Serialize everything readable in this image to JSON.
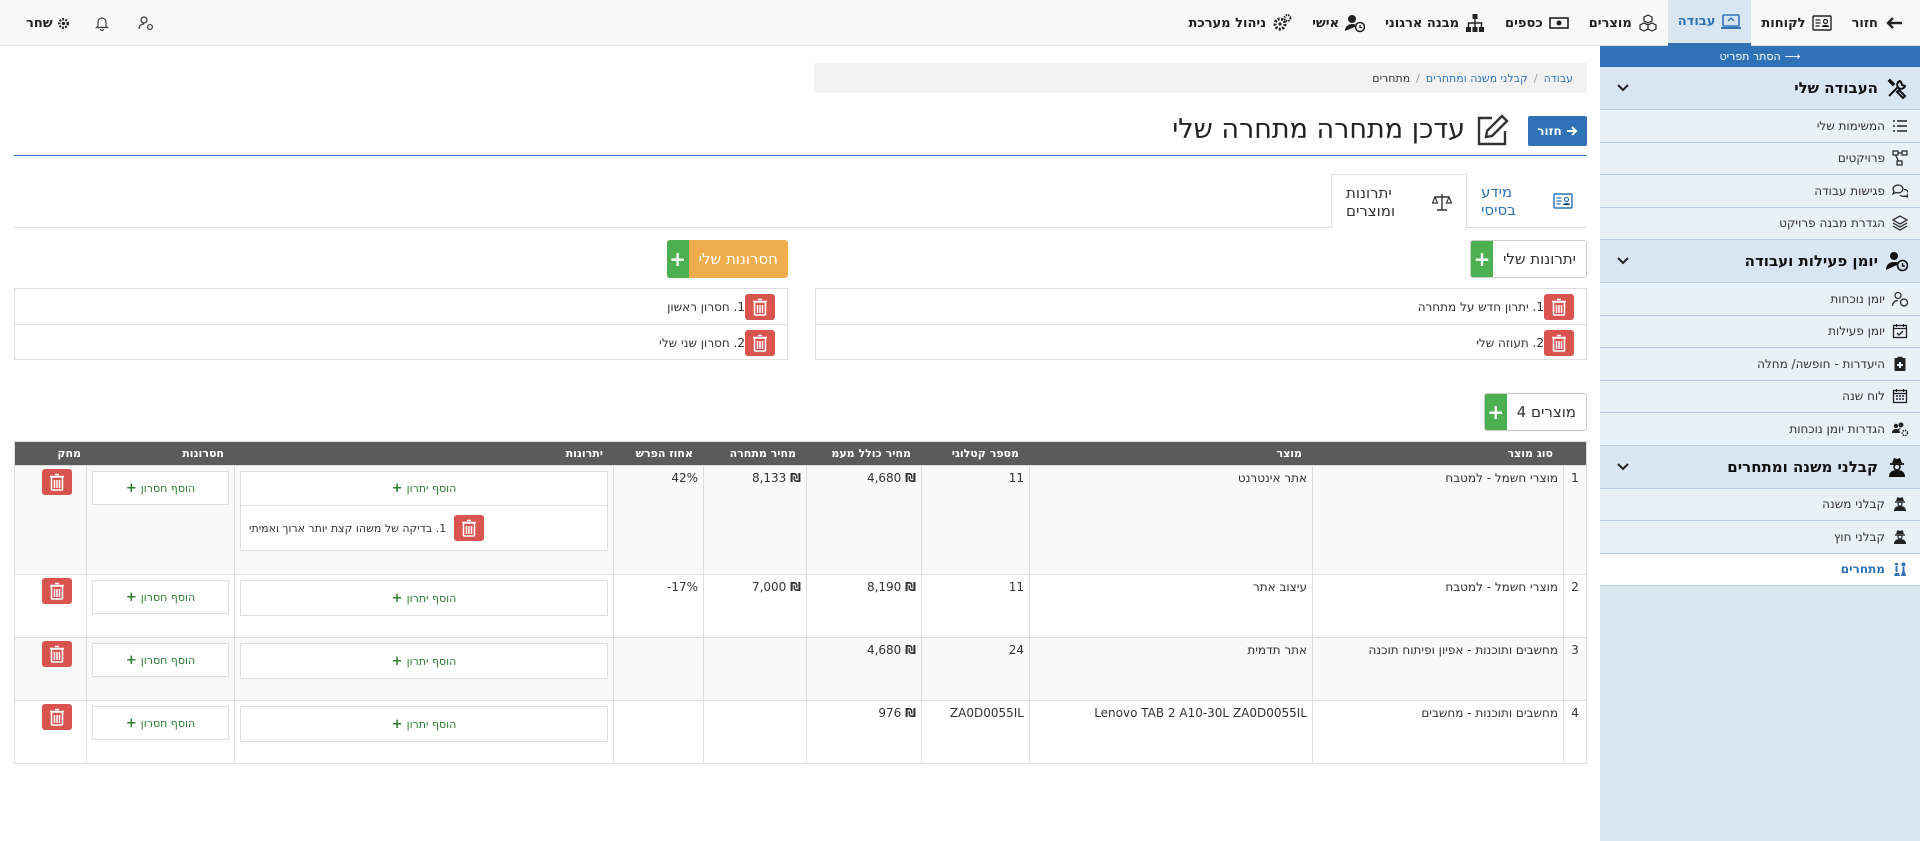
{
  "nav": {
    "back": "חזור",
    "items": [
      {
        "label": "לקוחות",
        "icon": "id-card-icon"
      },
      {
        "label": "עבודה",
        "icon": "laptop-icon",
        "active": true
      },
      {
        "label": "מוצרים",
        "icon": "cubes-icon"
      },
      {
        "label": "כספים",
        "icon": "money-icon"
      },
      {
        "label": "מבנה ארגוני",
        "icon": "sitemap-icon"
      },
      {
        "label": "אישי",
        "icon": "user-clock-icon"
      },
      {
        "label": "ניהול מערכת",
        "icon": "cogs-icon"
      }
    ],
    "logout": "שחר"
  },
  "sidebar": {
    "hide_menu": "הסתר תפריט",
    "sections": [
      {
        "title": "העבודה שלי",
        "items": [
          "המשימות שלי",
          "פרויקטים",
          "פגישות עבודה",
          "הגדרת מבנה פרויקט"
        ]
      },
      {
        "title": "יומן פעילות ועבודה",
        "items": [
          "יומן נוכחות",
          "יומן פעילות",
          "היעדרות - חופשה/ מחלה",
          "לוח שנה",
          "הגדרות יומן נוכחות"
        ]
      },
      {
        "title": "קבלני משנה ומתחרים",
        "items": [
          "קבלני משנה",
          "קבלני חוץ",
          "מתחרים"
        ]
      }
    ]
  },
  "breadcrumb": {
    "root": "עבודה",
    "middle": "קבלני משנה ומתחרים",
    "current": "מתחרים"
  },
  "page": {
    "back_button": "חזור",
    "title": "עדכן מתחרה מתחרה שלי"
  },
  "tabs": {
    "basic_info": "מידע בסיסי",
    "pros_products": "יתרונות ומוצרים"
  },
  "pros": {
    "button": "יתרונות שלי",
    "items": [
      "1. יתרון חדש על מתחרה",
      "2. תעוזה שלי"
    ]
  },
  "cons": {
    "button": "חסרונות שלי",
    "items": [
      "1. חסרון ראשון",
      "2. חסרון שני שלי"
    ]
  },
  "products": {
    "button": "מוצרים 4",
    "columns": [
      "סוג מוצר",
      "מוצר",
      "מספר קטלוגי",
      "מחיר כולל מעמ",
      "מחיר מתחרה",
      "אחוז הפרש",
      "יתרונות",
      "חסרונות",
      "מחק"
    ],
    "add_pro": "הוסף יתרון",
    "add_con": "הוסף חסרון",
    "shekel": "₪",
    "rows": [
      {
        "num": "1",
        "type": "מוצרי חשמל - למטבח",
        "product": "אתר אינטרנט",
        "catalog": "11",
        "price": "4,680",
        "competitor_price": "8,133",
        "diff": "42%",
        "pros": [
          "1. בדיקה של משהו קצת יותר ארוך ואמיתי"
        ]
      },
      {
        "num": "2",
        "type": "מוצרי חשמל - למטבח",
        "product": "עיצוב אתר",
        "catalog": "11",
        "price": "8,190",
        "competitor_price": "7,000",
        "diff": "-17%",
        "pros": []
      },
      {
        "num": "3",
        "type": "מחשבים ותוכנות - אפיון ופיתוח תוכנה",
        "product": "אתר תדמית",
        "catalog": "24",
        "price": "4,680",
        "competitor_price": "",
        "diff": "",
        "pros": []
      },
      {
        "num": "4",
        "type": "מחשבים ותוכנות - מחשבים",
        "product": "Lenovo TAB 2 A10-30L ZA0D0055IL",
        "catalog": "ZA0D0055IL",
        "price": "976",
        "competitor_price": "",
        "diff": "",
        "pros": []
      }
    ]
  }
}
